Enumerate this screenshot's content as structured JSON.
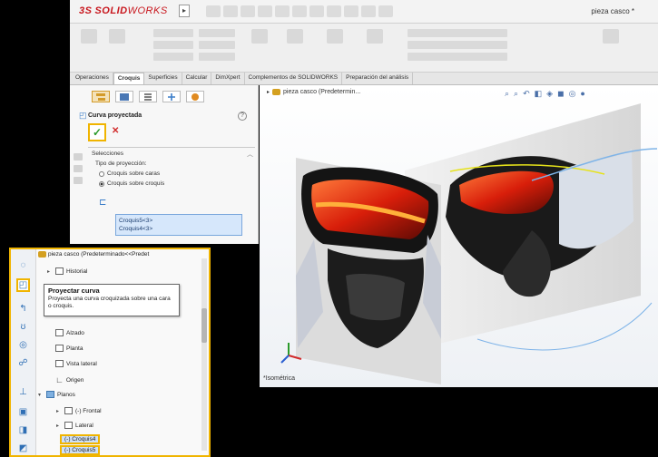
{
  "app": {
    "logo_ds": "3S",
    "logo_solid": "SOLID",
    "logo_works": "WORKS",
    "doc_title": "pieza casco *",
    "menu_arrow": "▸"
  },
  "tabs": [
    {
      "label": "Operaciones"
    },
    {
      "label": "Croquis"
    },
    {
      "label": "Superficies"
    },
    {
      "label": "Calcular"
    },
    {
      "label": "DimXpert"
    },
    {
      "label": "Complementos de SOLIDWORKS"
    },
    {
      "label": "Preparación del análisis"
    }
  ],
  "active_tab": "Croquis",
  "property_manager": {
    "title": "Curva proyectada",
    "ok_symbol": "✓",
    "cancel_symbol": "✕",
    "help_symbol": "?",
    "group_title": "Selecciones",
    "projection_label": "Tipo de proyección:",
    "option_1": "Croquis sobre caras",
    "option_2": "Croquis sobre croquis",
    "selected_option": "Croquis sobre croquis",
    "selection_1": "Croquis5<3>",
    "selection_2": "Croquis4<3>"
  },
  "feature_tree": {
    "header": "pieza casco (Predeterminado<<Predet",
    "items": {
      "historial": "Historial",
      "alzado": "Alzado",
      "planta": "Planta",
      "vista_lateral": "Vista lateral",
      "origen": "Origen",
      "planos": "Planos",
      "frontal": "(-) Frontal",
      "lateral": "Lateral",
      "croquis4": "(-) Croquis4",
      "croquis5": "(-) Croquis5"
    },
    "tooltip": {
      "title": "Proyectar curva",
      "body": "Proyecta una curva croquizada sobre una cara o croquis."
    }
  },
  "viewport": {
    "part_name": "pieza casco (Predetermin...",
    "view_label": "*Isométrica"
  },
  "colors": {
    "accent_highlight": "#f0b400",
    "brand_red": "#c8161d",
    "ok_green": "#2a9a2a",
    "selection_blue": "#d6e7fb"
  }
}
